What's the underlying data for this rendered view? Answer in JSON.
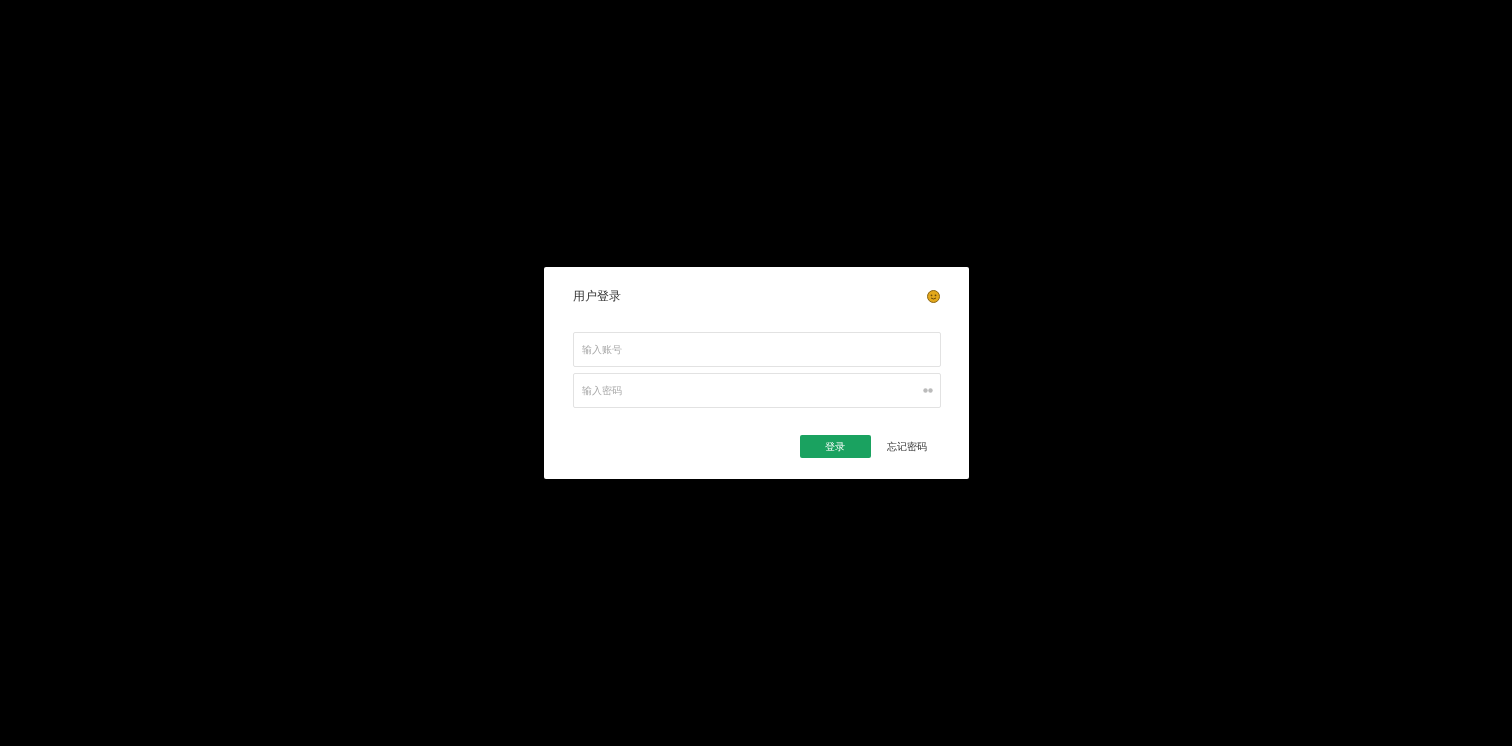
{
  "dialog": {
    "title": "用户登录",
    "fields": [
      {
        "placeholder": "输入账号",
        "kind": "text"
      },
      {
        "placeholder": "输入密码",
        "kind": "password"
      }
    ],
    "login_button": "登录",
    "forgot_link": "忘记密码"
  }
}
